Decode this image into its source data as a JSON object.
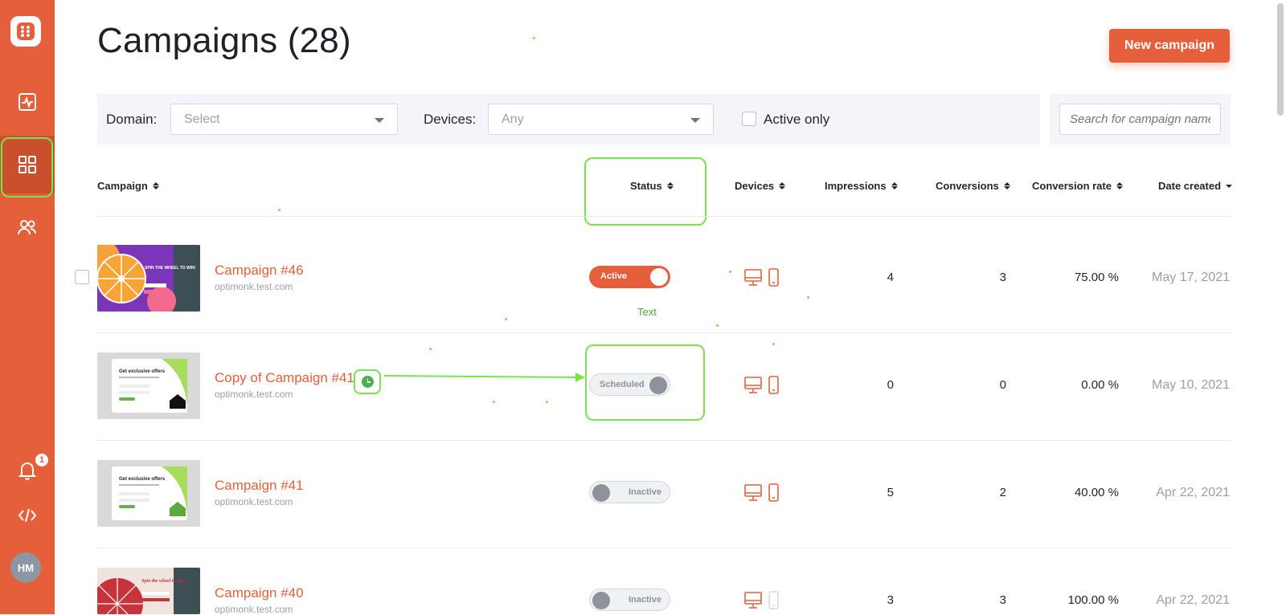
{
  "page": {
    "title": "Campaigns (28)",
    "new_campaign_label": "New campaign"
  },
  "sidebar": {
    "notification_count": "1",
    "avatar_initials": "HM",
    "items": [
      {
        "icon": "analytics-icon"
      },
      {
        "icon": "campaigns-grid-icon",
        "active": true
      },
      {
        "icon": "users-icon"
      },
      {
        "icon": "bell-icon"
      },
      {
        "icon": "code-icon"
      }
    ]
  },
  "filters": {
    "domain_label": "Domain:",
    "domain_placeholder": "Select",
    "devices_label": "Devices:",
    "devices_value": "Any",
    "active_only_label": "Active only",
    "active_only_checked": false,
    "search_placeholder": "Search for campaign name"
  },
  "table": {
    "columns": [
      "Campaign",
      "Status",
      "Devices",
      "Impressions",
      "Conversions",
      "Conversion rate",
      "Date created"
    ],
    "rows": [
      {
        "name": "Campaign #46",
        "domain": "optimonk.test.com",
        "status": "Active",
        "impressions": "4",
        "conversions": "3",
        "rate": "75.00 %",
        "date": "May 17, 2021"
      },
      {
        "name": "Copy of Campaign #41",
        "domain": "optimonk.test.com",
        "status": "Scheduled",
        "impressions": "0",
        "conversions": "0",
        "rate": "0.00 %",
        "date": "May 10, 2021"
      },
      {
        "name": "Campaign #41",
        "domain": "optimonk.test.com",
        "status": "Inactive",
        "impressions": "5",
        "conversions": "2",
        "rate": "40.00 %",
        "date": "Apr 22, 2021"
      },
      {
        "name": "Campaign #40",
        "domain": "optimonk.test.com",
        "status": "Inactive",
        "impressions": "3",
        "conversions": "3",
        "rate": "100.00 %",
        "date": "Apr 22, 2021"
      }
    ]
  },
  "thumbs": {
    "wheel_text": "SPIN THE WHEEL TO WIN!",
    "offer_title": "Get exclusive offers",
    "spin_text": "Spin the wheel to win!"
  },
  "annotation": {
    "text": "Text"
  },
  "colors": {
    "brand": "#e5603a",
    "highlight": "#7be34e",
    "sidebar_active": "#c94f2d"
  }
}
